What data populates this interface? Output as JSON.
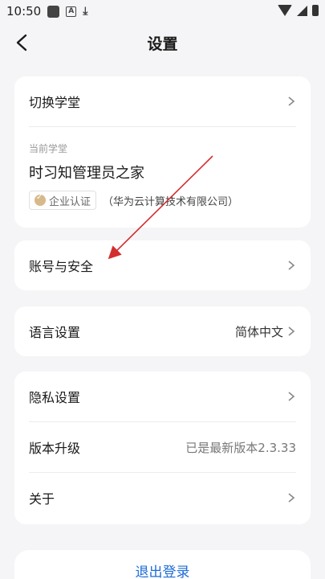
{
  "status_bar": {
    "time": "10:50"
  },
  "header": {
    "title": "设置"
  },
  "school_card": {
    "switch_label": "切换学堂",
    "current_label": "当前学堂",
    "current_name": "时习知管理员之家",
    "cert_badge": "企业认证",
    "company": "（华为云计算技术有限公司）"
  },
  "account": {
    "label": "账号与安全"
  },
  "language": {
    "label": "语言设置",
    "value": "简体中文"
  },
  "misc": {
    "privacy_label": "隐私设置",
    "version_label": "版本升级",
    "version_value": "已是最新版本2.3.33",
    "about_label": "关于"
  },
  "logout": {
    "label": "退出登录"
  },
  "colors": {
    "accent": "#1d6cd8",
    "arrow": "#d32f2f",
    "background": "#f5f5f7"
  }
}
